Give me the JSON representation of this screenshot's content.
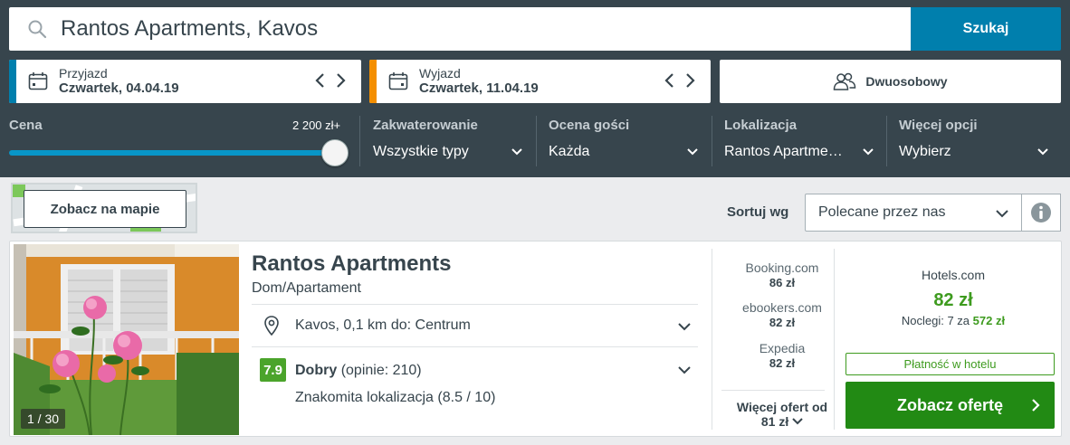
{
  "search": {
    "query": "Rantos Apartments, Kavos",
    "button": "Szukaj"
  },
  "dates": {
    "checkin": {
      "label": "Przyjazd",
      "value": "Czwartek, 04.04.19",
      "accent": "#007fad"
    },
    "checkout": {
      "label": "Wyjazd",
      "value": "Czwartek, 11.04.19",
      "accent": "#f48f00"
    }
  },
  "guests": {
    "label": "Dwuosobowy"
  },
  "filters": {
    "price": {
      "label": "Cena",
      "max": "2 200 zł+",
      "level": 1.0
    },
    "accommodation": {
      "label": "Zakwaterowanie",
      "value": "Wszystkie typy"
    },
    "rating": {
      "label": "Ocena gości",
      "value": "Każda"
    },
    "location": {
      "label": "Lokalizacja",
      "value": "Rantos Apartme…"
    },
    "more": {
      "label": "Więcej opcji",
      "value": "Wybierz"
    }
  },
  "map": {
    "button": "Zobacz na mapie"
  },
  "sort": {
    "label": "Sortuj wg",
    "value": "Polecane przez nas"
  },
  "hotel": {
    "name": "Rantos Apartments",
    "type": "Dom/Apartament",
    "photo_counter": "1 / 30",
    "location": "Kavos, 0,1 km do: Centrum",
    "rating_score": "7.9",
    "rating_word": "Dobry",
    "rating_reviews": "(opinie: 210)",
    "rating_sub": "Znakomita lokalizacja (8.5 / 10)",
    "offers": [
      {
        "site": "Booking.com",
        "price": "86 zł"
      },
      {
        "site": "ebookers.com",
        "price": "82 zł"
      },
      {
        "site": "Expedia",
        "price": "82 zł"
      }
    ],
    "more_offers_line1": "Więcej ofert od",
    "more_offers_line2": "81 zł",
    "best": {
      "site": "Hotels.com",
      "price": "82 zł",
      "nights_prefix": "Noclegi: 7 za",
      "nights_total": "572 zł",
      "pay_at_hotel": "Płatność w hotelu",
      "cta": "Zobacz ofertę"
    }
  },
  "colors": {
    "header": "#37454d",
    "primary": "#007fad",
    "green": "#3e9b1f",
    "cta": "#228a14",
    "rating": "#4ba42b"
  }
}
